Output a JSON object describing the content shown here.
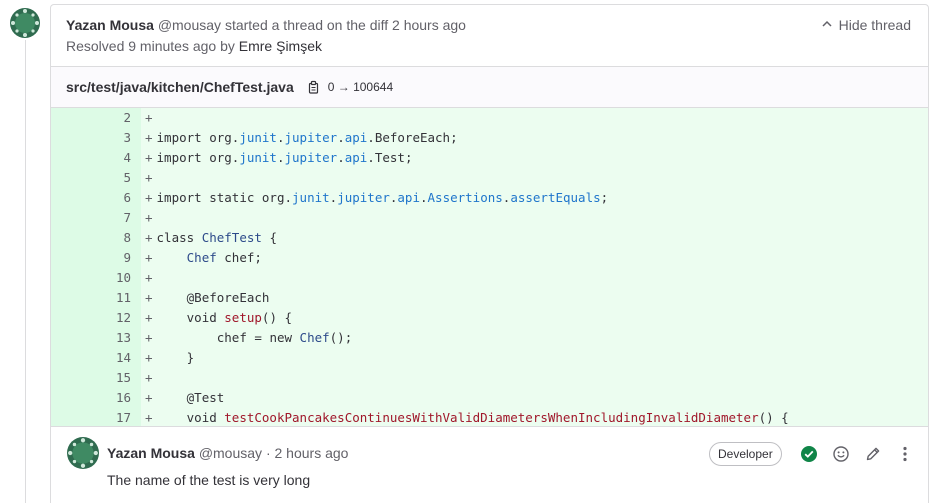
{
  "thread": {
    "author_name": "Yazan Mousa",
    "author_handle": "@mousay",
    "action_text": "started a thread on the diff",
    "time_ago": "2 hours ago",
    "resolved_prefix": "Resolved 9 minutes ago by",
    "resolver_name": "Emre Şimşek",
    "hide_label": "Hide thread"
  },
  "file": {
    "path": "src/test/java/kitchen/ChefTest.java",
    "mode_change": "0 → 100644"
  },
  "diff": {
    "marker": "+",
    "lines": [
      {
        "num": "2",
        "text": ""
      },
      {
        "num": "3",
        "text": "import org.junit.jupiter.api.BeforeEach;"
      },
      {
        "num": "4",
        "text": "import org.junit.jupiter.api.Test;"
      },
      {
        "num": "5",
        "text": ""
      },
      {
        "num": "6",
        "text": "import static org.junit.jupiter.api.Assertions.assertEquals;"
      },
      {
        "num": "7",
        "text": ""
      },
      {
        "num": "8",
        "text": "class ChefTest {"
      },
      {
        "num": "9",
        "text": "    Chef chef;"
      },
      {
        "num": "10",
        "text": ""
      },
      {
        "num": "11",
        "text": "    @BeforeEach"
      },
      {
        "num": "12",
        "text": "    void setup() {"
      },
      {
        "num": "13",
        "text": "        chef = new Chef();"
      },
      {
        "num": "14",
        "text": "    }"
      },
      {
        "num": "15",
        "text": ""
      },
      {
        "num": "16",
        "text": "    @Test"
      },
      {
        "num": "17",
        "text": "    void testCookPancakesContinuesWithValidDiametersWhenIncludingInvalidDiameter() {"
      }
    ]
  },
  "comment": {
    "author_name": "Yazan Mousa",
    "author_handle": "@mousay",
    "separator": "·",
    "time_ago": "2 hours ago",
    "role_badge": "Developer",
    "body": "The name of the test is very long"
  },
  "colors": {
    "diff_added_bg": "#ecfdf0",
    "diff_gutter_bg": "#ddfbe6",
    "resolved_green": "#108548",
    "avatar_green": "#2f6b4f"
  },
  "icons": {
    "avatar": "avatar-identicon",
    "hide": "chevron-up-icon",
    "copy": "copy-icon",
    "resolved": "check-circle-icon",
    "emoji": "smiley-icon",
    "edit": "pencil-icon",
    "more": "ellipsis-v-icon"
  }
}
